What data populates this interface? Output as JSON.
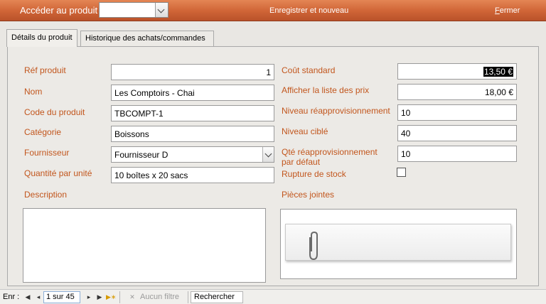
{
  "topbar": {
    "goto_label": "Accéder au produit",
    "goto_value": "",
    "save_new": "Enregistrer et nouveau",
    "close_prefix": "F",
    "close_rest": "ermer"
  },
  "tabs": {
    "details": "Détails du produit",
    "history": "Historique des achats/commandes"
  },
  "fields": {
    "ref_label": "Réf produit",
    "ref_value": "1",
    "name_label": "Nom",
    "name_value": "Les Comptoirs - Chai",
    "code_label": "Code du produit",
    "code_value": "TBCOMPT-1",
    "category_label": "Catégorie",
    "category_value": "Boissons",
    "supplier_label": "Fournisseur",
    "supplier_value": "Fournisseur D",
    "qty_unit_label": "Quantité par unité",
    "qty_unit_value": "10 boîtes x 20 sacs",
    "std_cost_label": "Coût standard",
    "std_cost_value": "13,50 €",
    "price_list_label": "Afficher la liste des prix",
    "price_list_value": "18,00 €",
    "reorder_level_label": "Niveau réapprovisionnement",
    "reorder_level_value": "10",
    "target_level_label": "Niveau ciblé",
    "target_level_value": "40",
    "default_reorder_label_1": "Qté réapprovisionnement",
    "default_reorder_label_2": "par défaut",
    "default_reorder_value": "10",
    "stockout_label": "Rupture de stock",
    "stockout_checked": false,
    "description_label": "Description",
    "attachments_label": "Pièces jointes"
  },
  "statusbar": {
    "record_label": "Enr :",
    "record_position": "1 sur 45",
    "filter_text": "Aucun filtre",
    "search_text": "Rechercher"
  },
  "colors": {
    "accent": "#cf6436",
    "label": "#c2561d"
  }
}
